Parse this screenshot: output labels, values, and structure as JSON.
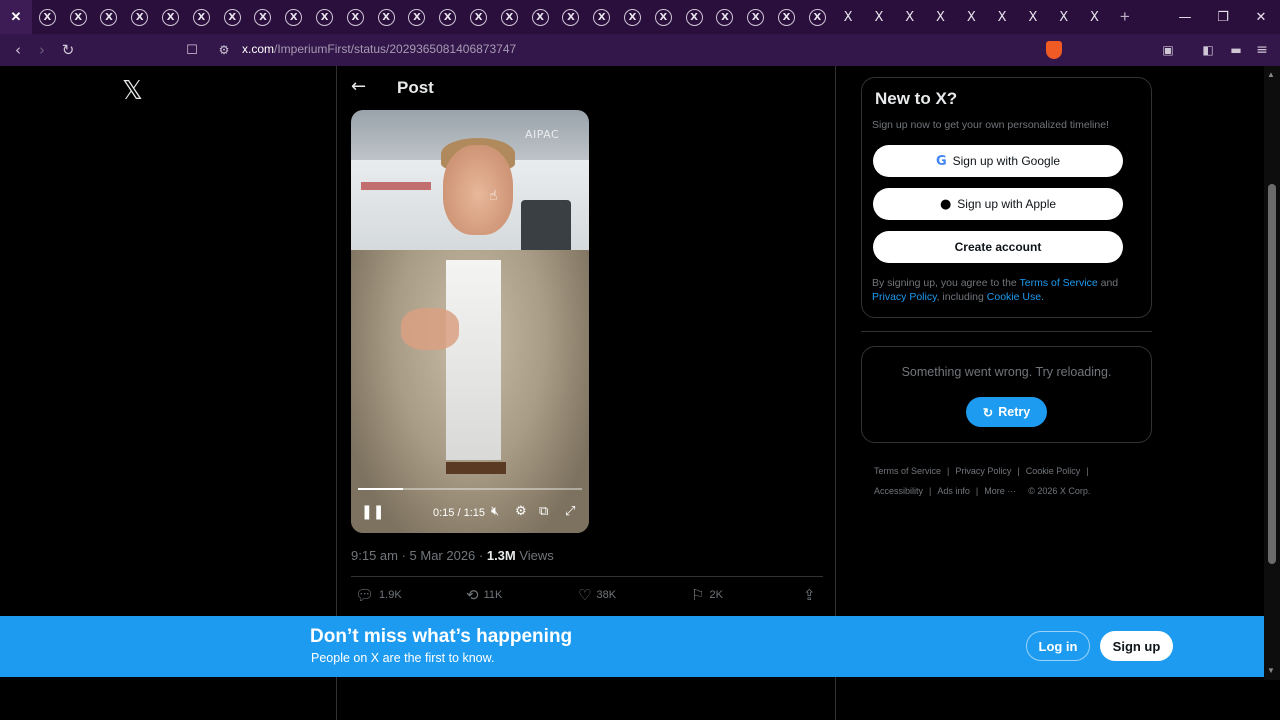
{
  "browser": {
    "active_tab_icon": "close-icon",
    "tab_count_circle": 26,
    "tab_count_plain": 9,
    "tab_glyph": "X",
    "new_tab_label": "+",
    "minimize": "—",
    "maximize": "❐",
    "close": "✕",
    "url_host": "x.com",
    "url_path": "/ImperiumFirst/status/2029365081406873747"
  },
  "nav": {
    "logo": "𝕏"
  },
  "post": {
    "header_title": "Post",
    "back_icon": "←",
    "video": {
      "watermark": "AIPAC",
      "time": "0:15 / 1:15",
      "progress": 0.2
    },
    "meta_time": "9:15 am · 5 Mar 2026 · ",
    "views_count": "1.3M",
    "views_label": " Views",
    "actions": {
      "replies": "1.9K",
      "reposts": "11K",
      "likes": "38K",
      "bookmarks": "2K"
    }
  },
  "sidebar": {
    "signup_title": "New to X?",
    "signup_sub": "Sign up now to get your own personalized timeline!",
    "google_label": "Sign up with Google",
    "apple_label": "Sign up with Apple",
    "create_label": "Create account",
    "legal_prefix": "By signing up, you agree to the ",
    "terms_link": "Terms of Service",
    "legal_and": " and ",
    "privacy_link": "Privacy Policy",
    "legal_including": ", including ",
    "cookie_link": "Cookie Use.",
    "error_text": "Something went wrong. Try reloading.",
    "retry_label": "Retry",
    "footer": [
      "Terms of Service",
      "Privacy Policy",
      "Cookie Policy",
      "Accessibility",
      "Ads info",
      "More ···",
      "© 2026 X Corp."
    ]
  },
  "banner": {
    "title": "Don’t miss what’s happening",
    "subtitle": "People on X are the first to know.",
    "login_label": "Log in",
    "signup_label": "Sign up"
  },
  "colors": {
    "accent": "#1d9bf0",
    "browser_chrome": "#2a0f3d"
  }
}
